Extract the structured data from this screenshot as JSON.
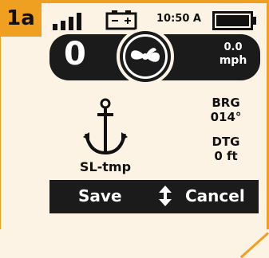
{
  "figure_tag": "1a",
  "status": {
    "time": "10:50 A",
    "signal_bars": 4,
    "icons": [
      "signal-icon",
      "battery-icon",
      "battery-full-icon"
    ]
  },
  "display": {
    "count": "0",
    "center_icon": "fan-icon",
    "speed_value": "0.0",
    "speed_unit": "mph"
  },
  "waypoint": {
    "icon": "anchor-icon",
    "name": "SL-tmp",
    "brg_label": "BRG",
    "brg_value": "014°",
    "dtg_label": "DTG",
    "dtg_value": "0 ft"
  },
  "actions": {
    "save": "Save",
    "cancel": "Cancel",
    "toggle_icon": "up-down-arrow-icon"
  },
  "colors": {
    "accent": "#f0a020",
    "panel": "#1b1b1b",
    "background": "#fdf3e4"
  }
}
